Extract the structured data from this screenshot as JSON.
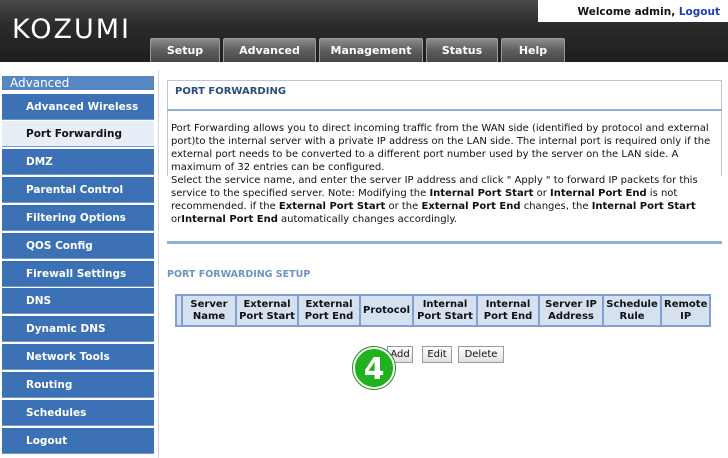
{
  "header": {
    "logo": "KOZUMI",
    "welcome_prefix": "Welcome admin, ",
    "logout_label": "Logout"
  },
  "tabs": [
    {
      "label": "Setup"
    },
    {
      "label": "Advanced"
    },
    {
      "label": "Management"
    },
    {
      "label": "Status"
    },
    {
      "label": "Help"
    }
  ],
  "sidebar": {
    "heading": "Advanced",
    "items": [
      {
        "label": "Advanced Wireless"
      },
      {
        "label": "Port Forwarding"
      },
      {
        "label": "DMZ"
      },
      {
        "label": "Parental Control"
      },
      {
        "label": "Filtering Options"
      },
      {
        "label": "QOS Config"
      },
      {
        "label": "Firewall Settings"
      },
      {
        "label": "DNS"
      },
      {
        "label": "Dynamic DNS"
      },
      {
        "label": "Network Tools"
      },
      {
        "label": "Routing"
      },
      {
        "label": "Schedules"
      },
      {
        "label": "Logout"
      }
    ]
  },
  "main": {
    "title": "PORT FORWARDING",
    "desc1": "Port Forwarding allows you to direct incoming traffic from the WAN side (identified by protocol and external port)to the internal server with a private IP address on the LAN side. The internal port is required only if the external port needs to be converted to a different port number used by the server on the LAN side. A maximum of 32 entries can be configured.",
    "desc2_parts": [
      "Select the service name, and enter the server IP address and click \" Apply \" to forward IP packets for this service to the specified server. Note: Modifying the ",
      "Internal Port Start",
      " or ",
      "Internal Port End",
      " is not recommended. if the ",
      "External Port Start",
      " or the ",
      "External Port End",
      " changes, the ",
      "Internal Port Start",
      " or",
      "Internal Port End",
      " automatically changes accordingly."
    ],
    "setup_title": "PORT FORWARDING SETUP",
    "table_headers": [
      "Server Name",
      "External Port Start",
      "External Port End",
      "Protocol",
      "Internal Port Start",
      "Internal Port End",
      "Server IP Address",
      "Schedule Rule",
      "Remote IP"
    ],
    "buttons": {
      "add": "Add",
      "edit": "Edit",
      "delete": "Delete"
    }
  },
  "annotation": {
    "step": "4",
    "color": "#1fb21f"
  }
}
